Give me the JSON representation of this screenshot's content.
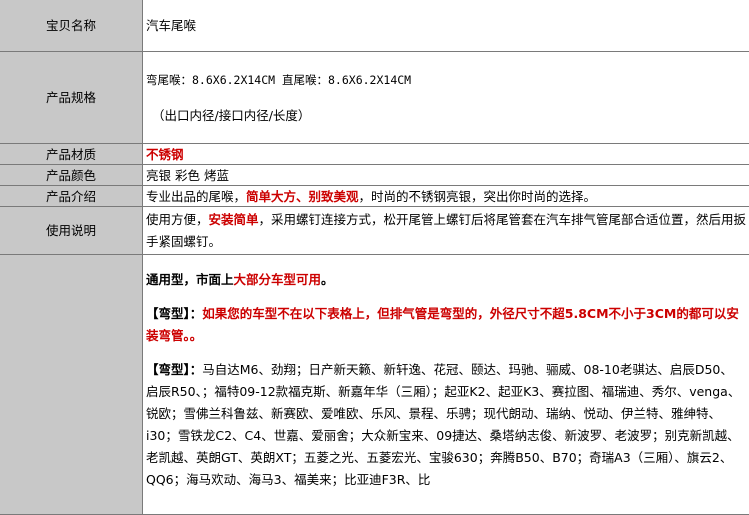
{
  "rows": {
    "name": {
      "label": "宝贝名称",
      "value": "汽车尾喉"
    },
    "spec": {
      "label": "产品规格",
      "line1": "弯尾喉：8.6X6.2X14CM 直尾喉：8.6X6.2X14CM",
      "line2": "（出口内径/接口内径/长度）"
    },
    "material": {
      "label": "产品材质",
      "value": "不锈钢"
    },
    "color": {
      "label": "产品颜色",
      "value": "亮银 彩色 烤蓝"
    },
    "intro": {
      "label": "产品介绍",
      "pre": "专业出品的尾喉，",
      "hl": "简单大方、别致美观",
      "post": "，时尚的不锈钢亮银，突出你时尚的选择。"
    },
    "usage": {
      "label": "使用说明",
      "pre": "使用方便，",
      "hl": "安装简单",
      "post": "，采用螺钉连接方式，松开尾管上螺钉后将尾管套在汽车排气管尾部合适位置，然后用扳手紧固螺钉。"
    },
    "compat": {
      "general_pre": "通用型，市面上",
      "general_hl": "大部分车型可用",
      "general_post": "。",
      "bent_tag": "【弯型】：",
      "bent_note": "如果您的车型不在以下表格上，但排气管是弯型的，外径尺寸不超5.8CM不小于3CM的都可以安装弯管。。",
      "models_tag": "【弯型】：",
      "models": "马自达M6、劲翔；日产新天籁、新轩逸、花冠、颐达、玛驰、骊威、08-10老骐达、启辰D50、启辰R50、；福特09-12款福克斯、新嘉年华（三厢）；起亚K2、起亚K3、赛拉图、福瑞迪、秀尔、venga、锐欧；雪佛兰科鲁兹、新赛欧、爱唯欧、乐风、景程、乐骋；现代朗动、瑞纳、悦动、伊兰特、雅绅特、i30；雪铁龙C2、C4、世嘉、爱丽舍；大众新宝来、09捷达、桑塔纳志俊、新波罗、老波罗；别克新凯越、老凯越、英朗GT、英朗XT；五菱之光、五菱宏光、宝骏630；奔腾B50、B70；奇瑞A3（三厢）、旗云2、QQ6；海马欢动、海马3、福美来；比亚迪F3R、比"
    }
  }
}
